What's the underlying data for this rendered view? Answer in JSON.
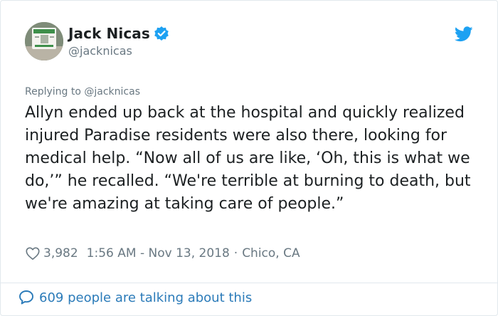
{
  "user": {
    "display_name": "Jack Nicas",
    "handle": "@jacknicas",
    "verified_icon": "verified-badge-icon"
  },
  "reply": {
    "text": "Replying to @jacknicas"
  },
  "tweet": {
    "text": "Allyn ended up back at the hospital and quickly realized injured Paradise residents were also there, looking for medical help. “Now all of us are like, ‘Oh, this is what we do,’” he recalled. “We're terrible at burning to death, but we're amazing at taking care of people.”"
  },
  "meta": {
    "like_count": "3,982",
    "timestamp": "1:56 AM - Nov 13, 2018",
    "separator": "·",
    "location": "Chico, CA"
  },
  "footer": {
    "talking_text": "609 people are talking about this"
  },
  "colors": {
    "twitter_blue": "#1da1f2",
    "link_blue": "#2b7bb9",
    "muted_gray": "#697882"
  }
}
